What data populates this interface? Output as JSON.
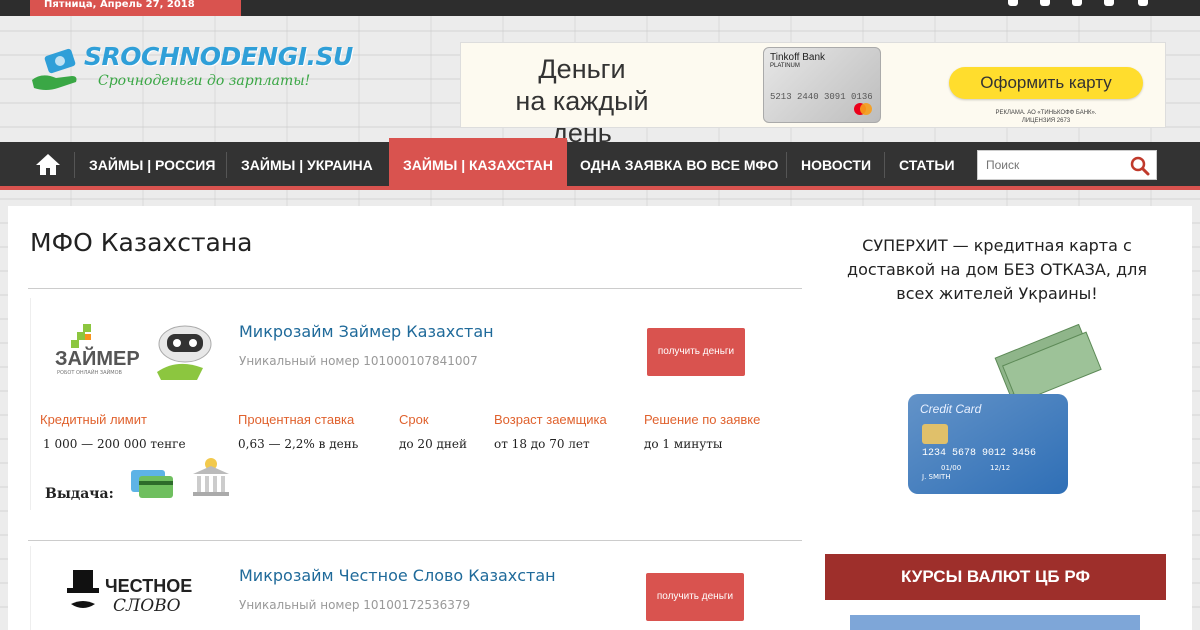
{
  "topbar": {
    "date": "Пятница, Апрель 27, 2018",
    "social_icons": [
      "facebook-icon",
      "vk-icon",
      "twitter-icon",
      "instagram-icon",
      "odnoklassniki-icon"
    ]
  },
  "logo": {
    "title": "SROCHNODENGI.SU",
    "subtitle": "Срочноденьги до зарплаты!"
  },
  "ad": {
    "headline_line1": "Деньги",
    "headline_line2": "на каждый день",
    "card_bank": "Tinkoff Bank",
    "card_tier": "PLATINUM",
    "card_number": "5213 2440 3091 0136",
    "button": "Оформить карту",
    "disclaimer_line1": "РЕКЛАМА. АО «ТИНЬКОФФ БАНК».",
    "disclaimer_line2": "ЛИЦЕНЗИЯ 2673",
    "accent_color": "#ffdd2d"
  },
  "nav": {
    "items": [
      {
        "label": "ЗАЙМЫ | РОССИЯ",
        "active": false
      },
      {
        "label": "ЗАЙМЫ | УКРАИНА",
        "active": false
      },
      {
        "label": "ЗАЙМЫ | КАЗАХСТАН",
        "active": true
      },
      {
        "label": "ОДНА ЗАЯВКА ВО ВСЕ МФО",
        "active": false
      },
      {
        "label": "НОВОСТИ",
        "active": false
      },
      {
        "label": "СТАТЬИ",
        "active": false
      }
    ],
    "search_placeholder": "Поиск",
    "accent_color": "#d9534f"
  },
  "main": {
    "title": "МФО Казахстана",
    "offers": [
      {
        "logo_text": "ЗАЙМЕР",
        "logo_tagline": "РОБОТ ОНЛАЙН ЗАЙМОВ",
        "title": "Микрозайм Займер Казахстан",
        "number": "Уникальный номер 101000107841007",
        "button": "получить деньги",
        "attrs": [
          {
            "label": "Кредитный лимит",
            "value": "1 000 — 200 000 тенге"
          },
          {
            "label": "Процентная ставка",
            "value": "0,63 — 2,2% в день"
          },
          {
            "label": "Срок",
            "value": "до 20 дней"
          },
          {
            "label": "Возраст заемщика",
            "value": "от 18 до 70 лет"
          },
          {
            "label": "Решение по заявке",
            "value": "до 1 минуты"
          }
        ],
        "issue_label": "Выдача:",
        "issue_icons": [
          "bank-card-icon",
          "bank-building-icon"
        ]
      },
      {
        "logo_text_line1": "ЧЕСТНОЕ",
        "logo_text_line2": "СЛОВО",
        "title": "Микрозайм Честное Слово Казахстан",
        "number": "Уникальный номер 10100172536379",
        "button": "получить деньги"
      }
    ]
  },
  "sidebar": {
    "promo_title": "СУПЕРХИТ — кредитная карта с доставкой на дом БЕЗ ОТКАЗА, для всех жителей Украины!",
    "card": {
      "label": "Credit Card",
      "number": "1234  5678  9012  3456",
      "valid_from": "01/00",
      "valid_to": "12/12",
      "holder": "J. SMITH"
    },
    "rates_title": "КУРСЫ ВАЛЮТ ЦБ РФ"
  }
}
